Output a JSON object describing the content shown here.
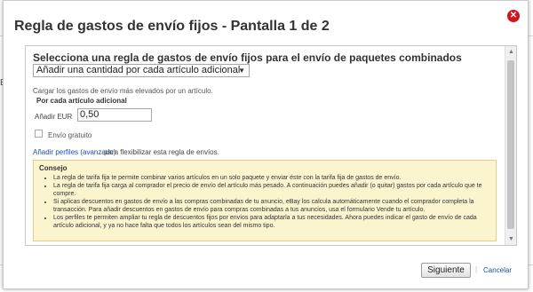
{
  "background": {
    "side_text": "E"
  },
  "dialog": {
    "title": "Regla de gastos de envío fijos - Pantalla 1 de 2",
    "close_icon": "close-icon"
  },
  "form": {
    "heading": "Selecciona una regla de gastos de envío fijos para el envío de paquetes combinados",
    "rule_select": "Añadir una cantidad por cada artículo adicional",
    "description": "Cargar los gastos de envío más elevados por un artículo.",
    "sub_heading": "Por cada artículo adicional",
    "add_label": "Añadir EUR",
    "add_value": "0,50",
    "free_shipping_label": "Envío gratuito",
    "advanced_link": "Añadir perfiles (avanzado)",
    "advanced_text": "para flexibilizar esta regla de envíos."
  },
  "tips": {
    "title": "Consejo",
    "items": [
      "La regla de tarifa fija te permite combinar varios artículos en un solo paquete y enviar éste con la tarifa fija de gastos de envío.",
      "La regla de tarifa fija carga al comprador el precio de envío del artículo más pesado. A continuación puedes añadir (o quitar) gastos por cada artículo que te compre.",
      "Si aplicas descuentos en gastos de envío a las compras combinadas de tu anuncio, eBay los calcula automáticamente cuando el comprador completa la transacción. Para añadir descuentos en gastos de envío para compras combinadas a tus anuncios, usa el formulario Vende tu artículo.",
      "Los perfiles te permiten ampliar tu regla de descuentos fijos por envíos para adaptarla a tus necesidades. Ahora puedes indicar el gasto de envío de cada artículo adicional, y ya no hace falta que todos los artículos sean del mismo tipo."
    ]
  },
  "footer": {
    "next_label": "Siguiente",
    "separator": "|",
    "cancel_label": "Cancelar"
  },
  "colors": {
    "close_button": "#d6121f",
    "link": "#1a4ea8",
    "tips_background": "#fbf5cf"
  }
}
